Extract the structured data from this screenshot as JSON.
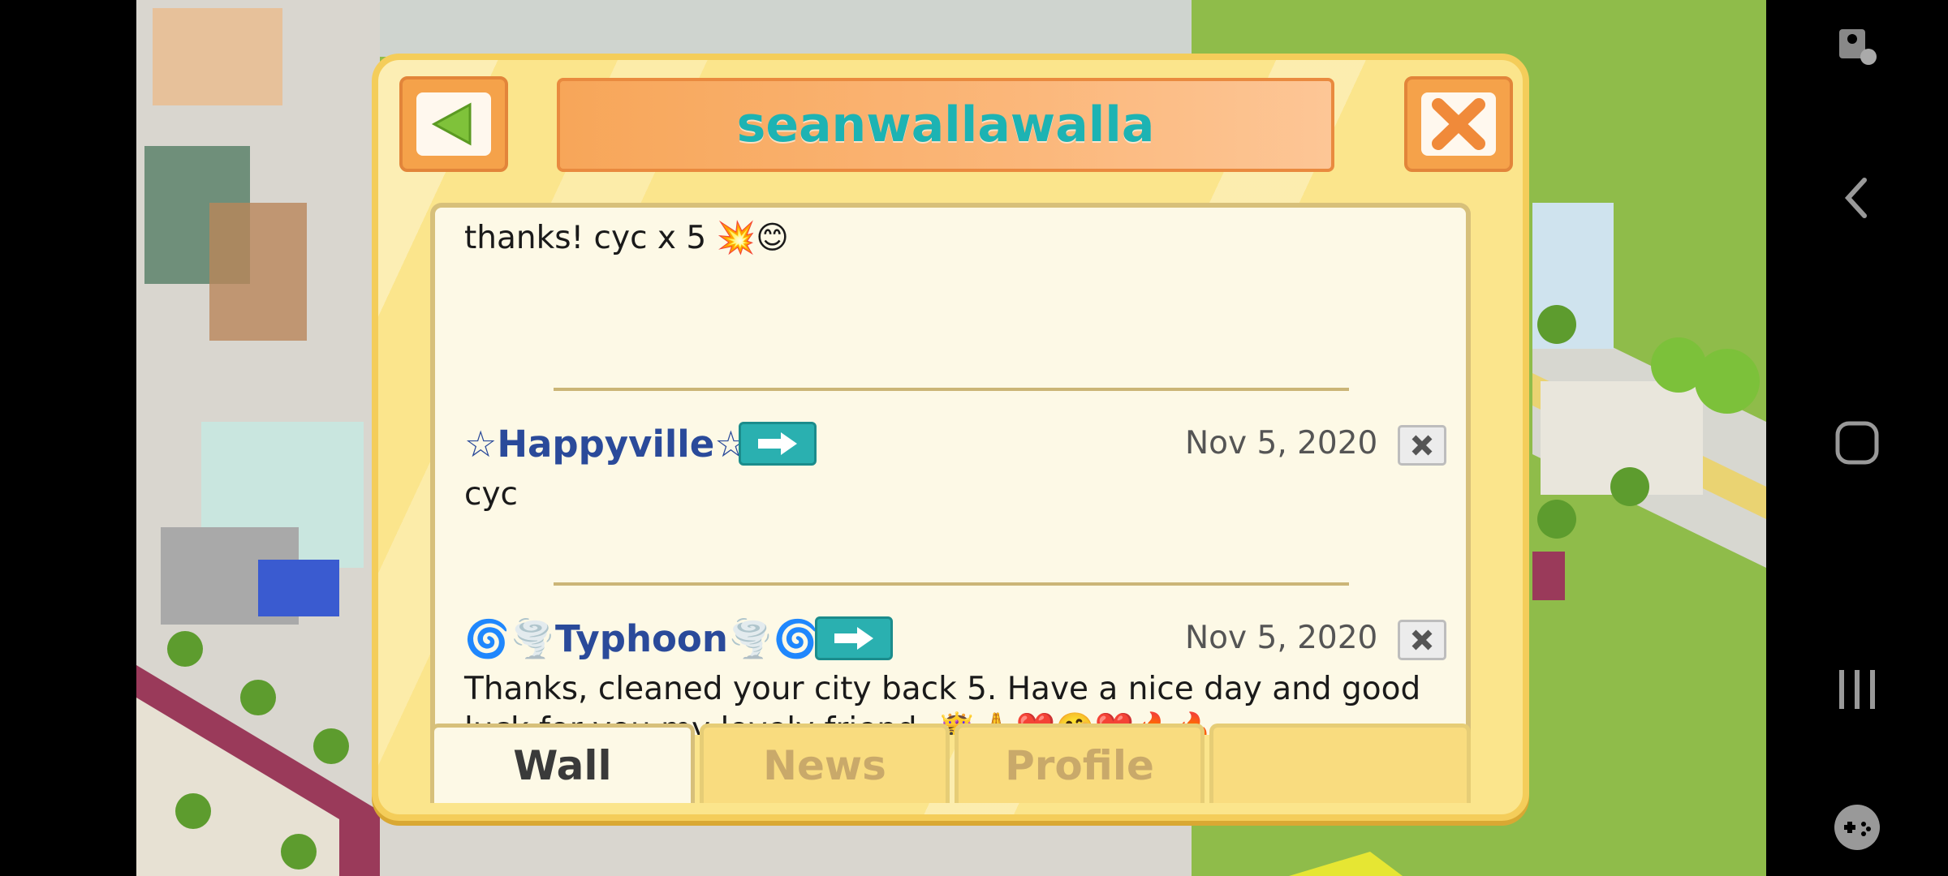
{
  "dialog": {
    "title": "seanwallawalla",
    "back_icon": "back-arrow-icon",
    "close_icon": "close-x-icon"
  },
  "posts": [
    {
      "text": "thanks! cyc x 5 💥😊"
    },
    {
      "author": "☆Happyville☆",
      "date": "Nov 5, 2020",
      "text": "cyc"
    },
    {
      "author": "🌀🌪️Typhoon🌪️🌀",
      "date": "Nov 5, 2020",
      "text_line1": "Thanks, cleaned your city back 5. Have a nice day and good",
      "text_line2": "luck for you my lovely friend. 👸🙏❤️🤗❤️🔥🔥"
    }
  ],
  "tabs": [
    "Wall",
    "News",
    "Profile"
  ],
  "colors": {
    "title_text": "#1db3b3",
    "author_text": "#2a4a9a",
    "dialog_bg": "#fbe58c"
  },
  "navbar": {
    "icons": [
      "accessibility-icon",
      "back-icon",
      "home-icon",
      "recents-icon",
      "game-controller-icon"
    ]
  }
}
